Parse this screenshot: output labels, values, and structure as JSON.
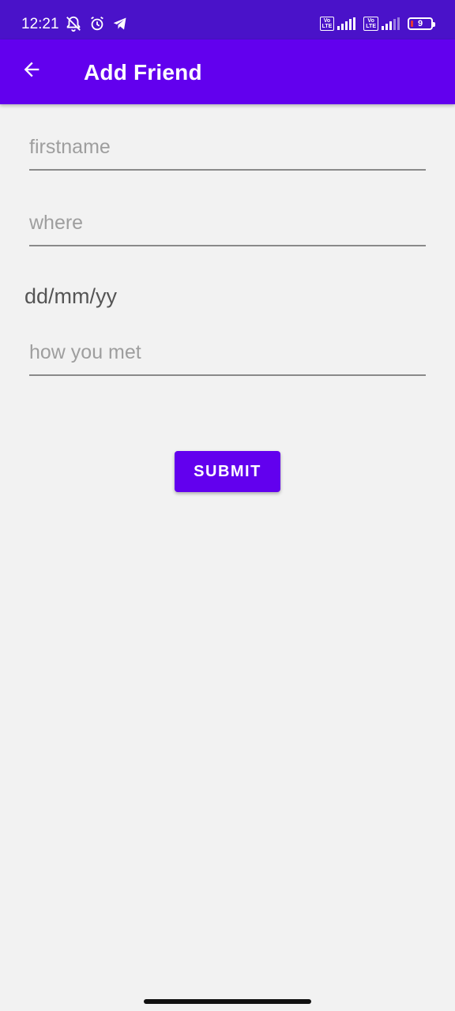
{
  "status_bar": {
    "time": "12:21",
    "battery_level": "9",
    "icons": [
      "mute-notifications-icon",
      "alarm-icon",
      "telegram-icon",
      "volte-icon",
      "signal-icon",
      "battery-icon"
    ],
    "volte_label_top": "Vo",
    "volte_label_bottom": "LTE"
  },
  "app_bar": {
    "title": "Add Friend",
    "back_icon": "arrow-back-icon"
  },
  "form": {
    "firstname_placeholder": "firstname",
    "where_placeholder": "where",
    "date_text": "dd/mm/yy",
    "how_met_placeholder": "how you met",
    "submit_label": "SUBMIT"
  },
  "colors": {
    "status_bar": "#4a12c9",
    "primary": "#6200ee",
    "background": "#f2f2f2"
  }
}
